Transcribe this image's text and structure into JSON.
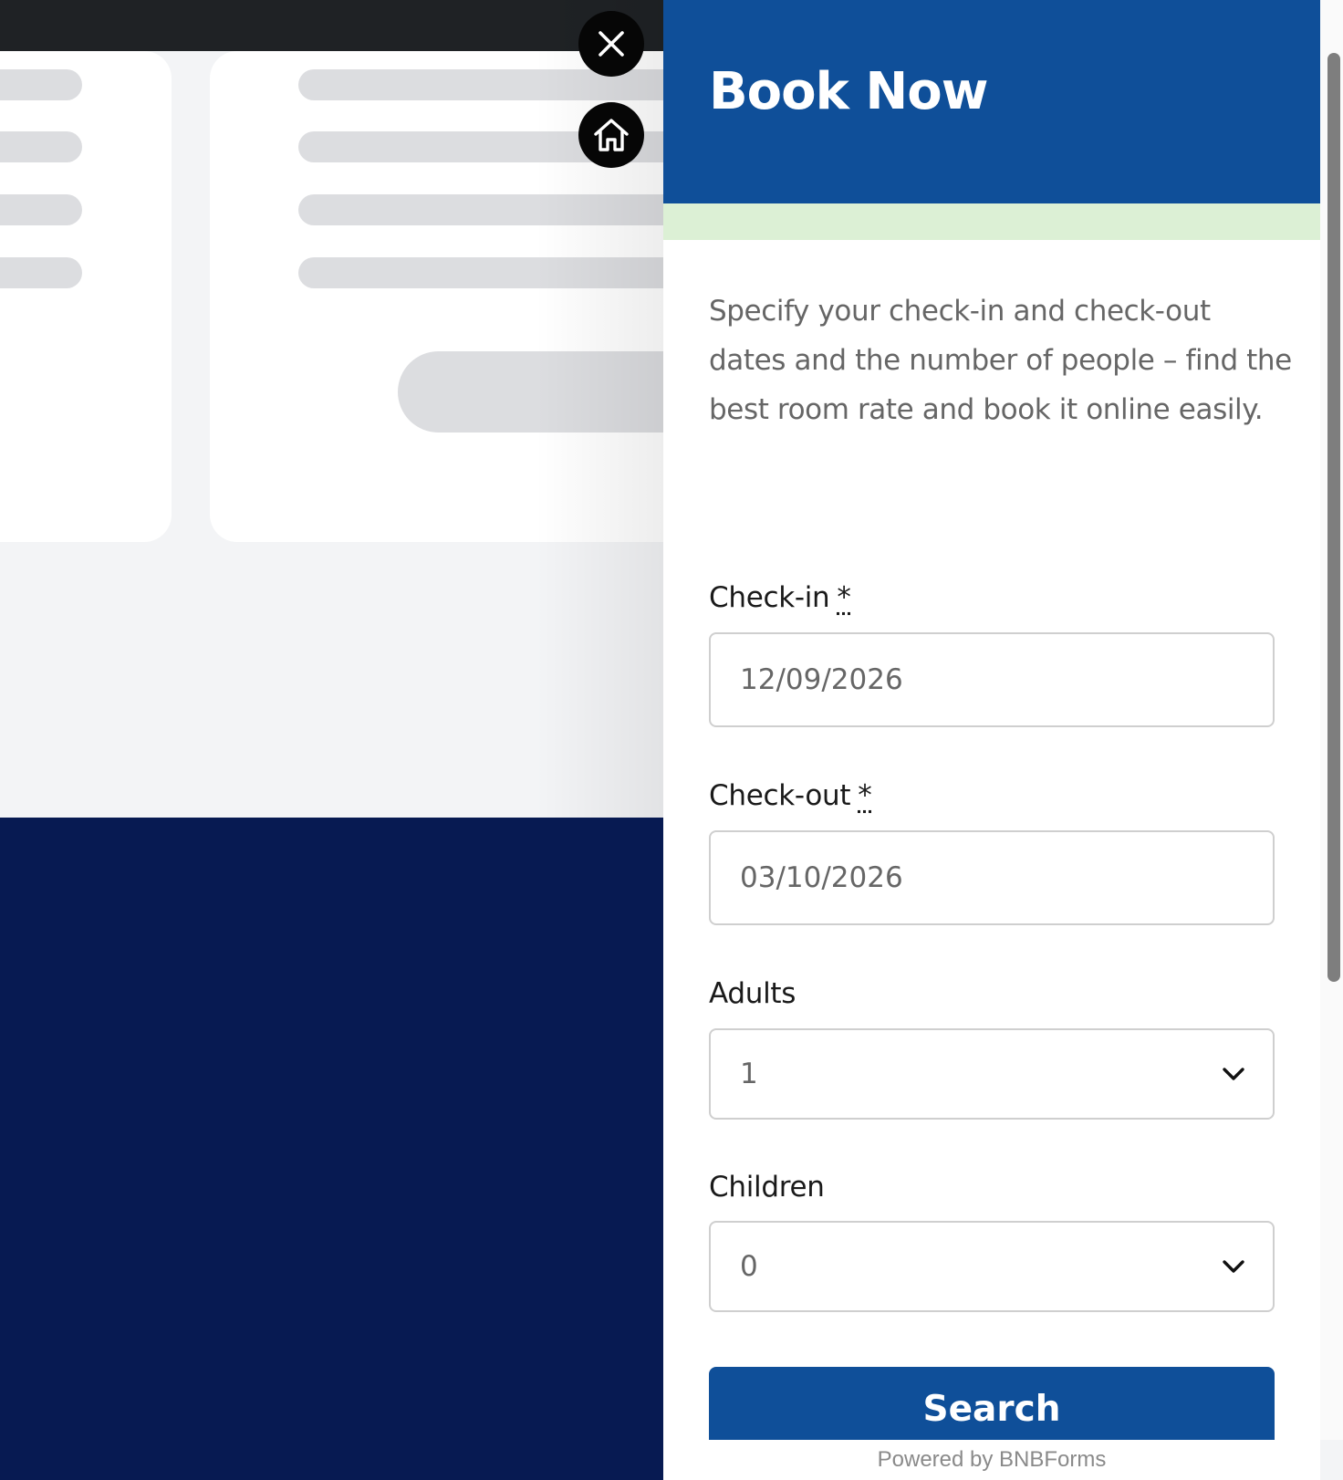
{
  "floating_buttons": {
    "close_icon": "close-icon",
    "home_icon": "home-icon"
  },
  "panel": {
    "title": "Book Now",
    "intro": "Specify your check-in and check-out dates and the number of people – find the best room rate and book it online easily.",
    "fields": {
      "checkin": {
        "label": "Check-in",
        "required_mark": "*",
        "value": "12/09/2026"
      },
      "checkout": {
        "label": "Check-out",
        "required_mark": "*",
        "value": "03/10/2026"
      },
      "adults": {
        "label": "Adults",
        "value": "1",
        "icon": "chevron-down-icon"
      },
      "children": {
        "label": "Children",
        "value": "0",
        "icon": "chevron-down-icon"
      }
    },
    "search_label": "Search",
    "powered_by": "Powered by BNBForms"
  },
  "colors": {
    "header_blue": "#0f4f99",
    "accent_green": "#dcf0d5",
    "footer_navy": "#071a52",
    "topbar_dark": "#1f2225"
  }
}
